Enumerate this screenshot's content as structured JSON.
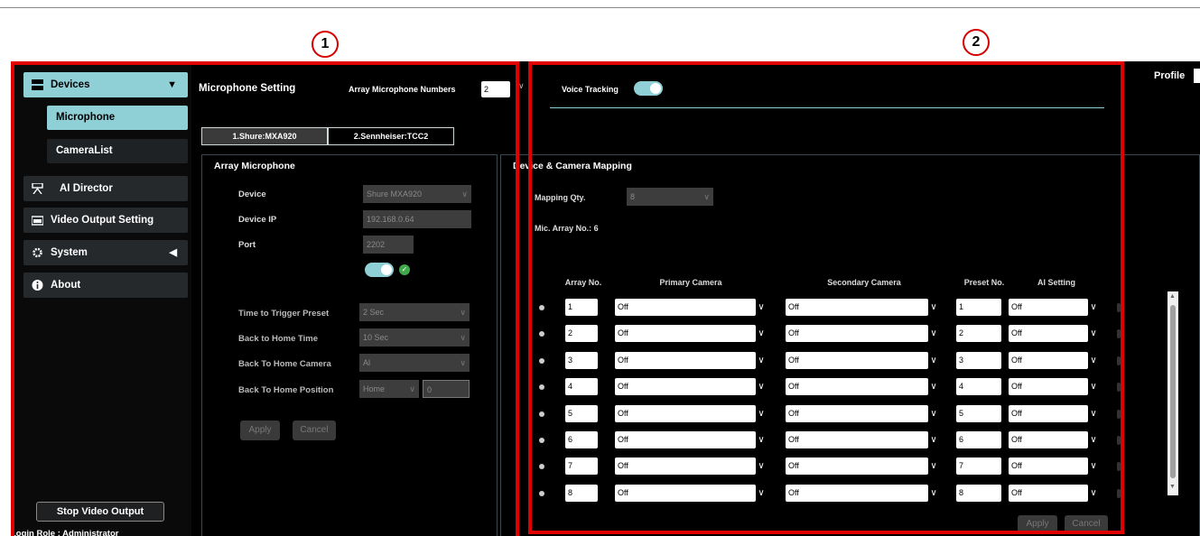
{
  "callouts": [
    "1",
    "2"
  ],
  "sidebar": {
    "items": [
      {
        "label": "Devices",
        "icon": "devices-icon"
      },
      {
        "label": "AI Director",
        "icon": "ai-director-icon"
      },
      {
        "label": "Video Output Setting",
        "icon": "video-output-icon"
      },
      {
        "label": "System",
        "icon": "gear-icon"
      },
      {
        "label": "About",
        "icon": "info-icon"
      }
    ],
    "subitems": [
      {
        "label": "Microphone"
      },
      {
        "label": "CameraList"
      }
    ],
    "stop_button": "Stop Video Output",
    "login_role": "Login Role :  Administrator"
  },
  "header": {
    "title": "Microphone Setting",
    "array_numbers_label": "Array Microphone Numbers",
    "array_numbers_value": "2",
    "voice_tracking_label": "Voice Tracking",
    "profile_label": "Profile"
  },
  "tabs": [
    {
      "label": "1.Shure:MXA920"
    },
    {
      "label": "2.Sennheiser:TCC2"
    }
  ],
  "array_mic": {
    "title": "Array Microphone",
    "device_label": "Device",
    "device_value": "Shure MXA920",
    "ip_label": "Device IP",
    "ip_value": "192.168.0.64",
    "port_label": "Port",
    "port_value": "2202",
    "trigger_label": "Time to Trigger Preset",
    "trigger_value": "2 Sec",
    "back_home_time_label": "Back to Home Time",
    "back_home_time_value": "10 Sec",
    "back_home_camera_label": "Back To Home Camera",
    "back_home_camera_value": "Al",
    "back_home_position_label": "Back To Home Position",
    "back_home_position_value": "Home",
    "back_home_position_num": "0",
    "apply": "Apply",
    "cancel": "Cancel"
  },
  "mapping": {
    "title": "Device & Camera Mapping",
    "qty_label": "Mapping Qty.",
    "qty_value": "8",
    "mic_array_no": "Mic. Array No.: 6",
    "columns": [
      "Array No.",
      "Primary Camera",
      "Secondary Camera",
      "Preset No.",
      "AI Setting"
    ],
    "rows": [
      {
        "array": "1",
        "primary": "Off",
        "secondary": "Off",
        "preset": "1",
        "ai": "Off"
      },
      {
        "array": "2",
        "primary": "Off",
        "secondary": "Off",
        "preset": "2",
        "ai": "Off"
      },
      {
        "array": "3",
        "primary": "Off",
        "secondary": "Off",
        "preset": "3",
        "ai": "Off"
      },
      {
        "array": "4",
        "primary": "Off",
        "secondary": "Off",
        "preset": "4",
        "ai": "Off"
      },
      {
        "array": "5",
        "primary": "Off",
        "secondary": "Off",
        "preset": "5",
        "ai": "Off"
      },
      {
        "array": "6",
        "primary": "Off",
        "secondary": "Off",
        "preset": "6",
        "ai": "Off"
      },
      {
        "array": "7",
        "primary": "Off",
        "secondary": "Off",
        "preset": "7",
        "ai": "Off"
      },
      {
        "array": "8",
        "primary": "Off",
        "secondary": "Off",
        "preset": "8",
        "ai": "Off"
      }
    ],
    "apply": "Apply",
    "cancel": "Cancel"
  },
  "colors": {
    "accent": "#8fcfd6",
    "highlight_box": "#e00000",
    "background": "#000000"
  }
}
